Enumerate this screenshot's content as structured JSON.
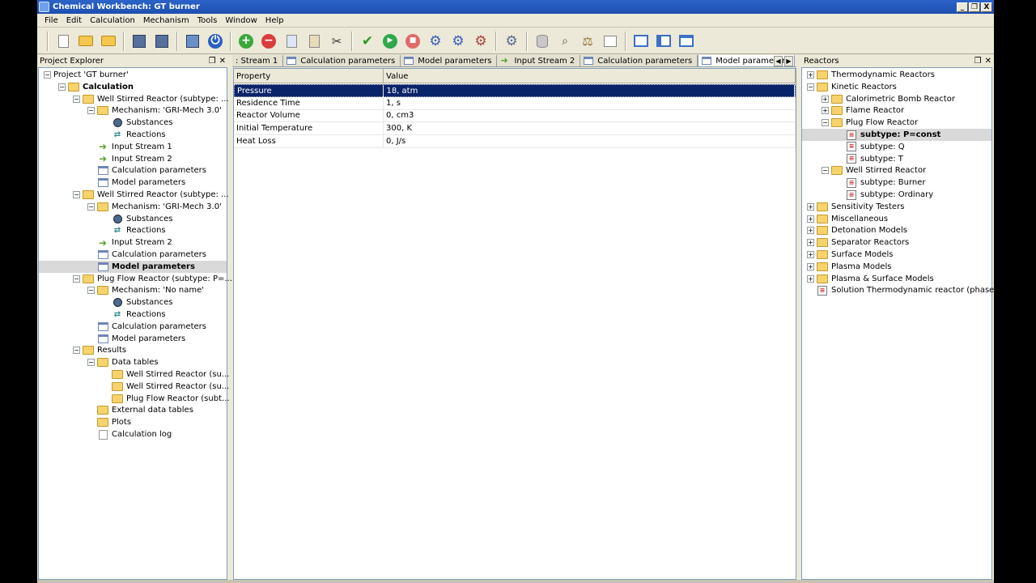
{
  "window": {
    "title": "Chemical Workbench: GT burner",
    "controls": [
      "_",
      "❐",
      "X"
    ]
  },
  "menu": [
    "File",
    "Edit",
    "Calculation",
    "Mechanism",
    "Tools",
    "Window",
    "Help"
  ],
  "left_panel": {
    "title": "Project Explorer",
    "tree": [
      {
        "label": "Project 'GT burner'",
        "level": 0,
        "icon": "none",
        "expander": "minus"
      },
      {
        "label": "Calculation",
        "level": 1,
        "icon": "folder",
        "expander": "minus",
        "bold": true
      },
      {
        "label": "Well Stirred Reactor (subtype: ...",
        "level": 2,
        "icon": "folder",
        "expander": "minus"
      },
      {
        "label": "Mechanism: 'GRI-Mech 3.0'",
        "level": 3,
        "icon": "folder",
        "expander": "minus"
      },
      {
        "label": "Substances",
        "level": 4,
        "icon": "substances"
      },
      {
        "label": "Reactions",
        "level": 4,
        "icon": "reactions"
      },
      {
        "label": "Input Stream 1",
        "level": 3,
        "icon": "arrow"
      },
      {
        "label": "Input Stream 2",
        "level": 3,
        "icon": "arrow"
      },
      {
        "label": "Calculation parameters",
        "level": 3,
        "icon": "table"
      },
      {
        "label": "Model parameters",
        "level": 3,
        "icon": "table"
      },
      {
        "label": "Well Stirred Reactor (subtype: ...",
        "level": 2,
        "icon": "folder",
        "expander": "minus"
      },
      {
        "label": "Mechanism: 'GRI-Mech 3.0'",
        "level": 3,
        "icon": "folder",
        "expander": "minus"
      },
      {
        "label": "Substances",
        "level": 4,
        "icon": "substances"
      },
      {
        "label": "Reactions",
        "level": 4,
        "icon": "reactions"
      },
      {
        "label": "Input Stream 2",
        "level": 3,
        "icon": "arrow"
      },
      {
        "label": "Calculation parameters",
        "level": 3,
        "icon": "table"
      },
      {
        "label": "Model parameters",
        "level": 3,
        "icon": "table",
        "selected": true
      },
      {
        "label": "Plug Flow Reactor (subtype: P=...",
        "level": 2,
        "icon": "folder",
        "expander": "minus"
      },
      {
        "label": "Mechanism: 'No name'",
        "level": 3,
        "icon": "folder",
        "expander": "minus"
      },
      {
        "label": "Substances",
        "level": 4,
        "icon": "substances"
      },
      {
        "label": "Reactions",
        "level": 4,
        "icon": "reactions"
      },
      {
        "label": "Calculation parameters",
        "level": 3,
        "icon": "table"
      },
      {
        "label": "Model parameters",
        "level": 3,
        "icon": "table"
      },
      {
        "label": "Results",
        "level": 2,
        "icon": "folder",
        "expander": "minus"
      },
      {
        "label": "Data tables",
        "level": 3,
        "icon": "folder",
        "expander": "minus"
      },
      {
        "label": "Well Stirred Reactor (su...",
        "level": 4,
        "icon": "folder"
      },
      {
        "label": "Well Stirred Reactor (su...",
        "level": 4,
        "icon": "folder"
      },
      {
        "label": "Plug Flow Reactor (subt...",
        "level": 4,
        "icon": "folder"
      },
      {
        "label": "External data tables",
        "level": 3,
        "icon": "folder"
      },
      {
        "label": "Plots",
        "level": 3,
        "icon": "folder"
      },
      {
        "label": "Calculation log",
        "level": 3,
        "icon": "log"
      }
    ]
  },
  "center": {
    "tabs": [
      {
        "label": ": Stream 1",
        "icon": "none"
      },
      {
        "label": "Calculation parameters",
        "icon": "table"
      },
      {
        "label": "Model parameters",
        "icon": "table"
      },
      {
        "label": "Input Stream 2",
        "icon": "arrow"
      },
      {
        "label": "Calculation parameters",
        "icon": "table"
      },
      {
        "label": "Model parameters",
        "icon": "table",
        "active": true
      }
    ],
    "grid": {
      "headers": [
        "Property",
        "Value"
      ],
      "rows": [
        {
          "property": "Pressure",
          "value": "18, atm",
          "selected": true
        },
        {
          "property": "Residence Time",
          "value": "1, s"
        },
        {
          "property": "Reactor Volume",
          "value": "0, cm3"
        },
        {
          "property": "Initial Temperature",
          "value": "300, K"
        },
        {
          "property": "Heat Loss",
          "value": "0, J/s"
        }
      ]
    }
  },
  "right_panel": {
    "title": "Reactors",
    "tree": [
      {
        "label": "Thermodynamic Reactors",
        "level": 0,
        "icon": "folder",
        "expander": "plus"
      },
      {
        "label": "Kinetic Reactors",
        "level": 0,
        "icon": "folder",
        "expander": "minus"
      },
      {
        "label": "Calorimetric Bomb Reactor",
        "level": 1,
        "icon": "folder",
        "expander": "plus"
      },
      {
        "label": "Flame Reactor",
        "level": 1,
        "icon": "folder",
        "expander": "plus"
      },
      {
        "label": "Plug Flow Reactor",
        "level": 1,
        "icon": "folder",
        "expander": "minus"
      },
      {
        "label": "subtype: P=const",
        "level": 2,
        "icon": "reactor",
        "selected": true
      },
      {
        "label": "subtype: Q",
        "level": 2,
        "icon": "reactor"
      },
      {
        "label": "subtype: T",
        "level": 2,
        "icon": "reactor"
      },
      {
        "label": "Well Stirred Reactor",
        "level": 1,
        "icon": "folder",
        "expander": "minus"
      },
      {
        "label": "subtype: Burner",
        "level": 2,
        "icon": "reactor"
      },
      {
        "label": "subtype: Ordinary",
        "level": 2,
        "icon": "reactor"
      },
      {
        "label": "Sensitivity Testers",
        "level": 0,
        "icon": "folder",
        "expander": "plus"
      },
      {
        "label": "Miscellaneous",
        "level": 0,
        "icon": "folder",
        "expander": "plus"
      },
      {
        "label": "Detonation Models",
        "level": 0,
        "icon": "folder",
        "expander": "plus"
      },
      {
        "label": "Separator Reactors",
        "level": 0,
        "icon": "folder",
        "expander": "plus"
      },
      {
        "label": "Surface Models",
        "level": 0,
        "icon": "folder",
        "expander": "plus"
      },
      {
        "label": "Plasma Models",
        "level": 0,
        "icon": "folder",
        "expander": "plus"
      },
      {
        "label": "Plasma & Surface Models",
        "level": 0,
        "icon": "folder",
        "expander": "plus"
      },
      {
        "label": "Solution Thermodynamic reactor (phase ...",
        "level": 0,
        "icon": "reactor"
      }
    ]
  },
  "toolbar_icons": [
    "new-document-icon",
    "open-folder-icon",
    "open-project-icon",
    "save-icon",
    "save-as-icon",
    "project-settings-icon",
    "power-icon",
    "add-icon",
    "remove-icon",
    "copy-icon",
    "paste-icon",
    "cut-icon",
    "check-icon",
    "run-icon",
    "stop-icon",
    "gear-add-icon",
    "gear-run-icon",
    "gear-icon",
    "gear-settings-icon",
    "database-icon",
    "search-icon",
    "balance-icon",
    "chart-icon",
    "cascade-windows-icon",
    "tile-windows-icon",
    "window-icon"
  ]
}
